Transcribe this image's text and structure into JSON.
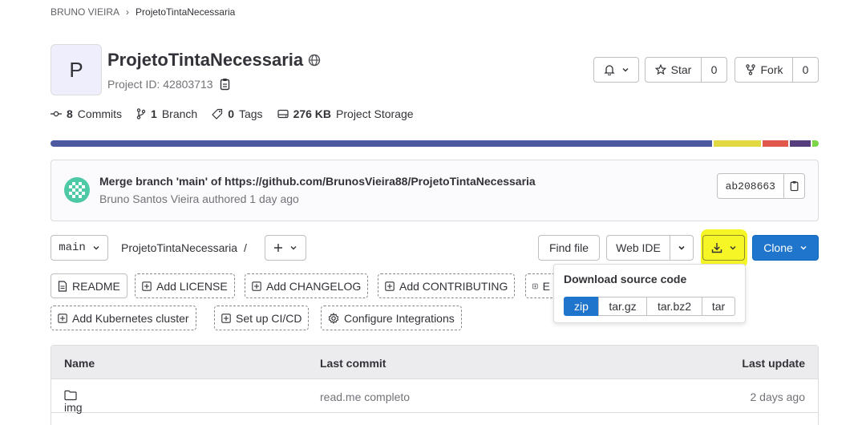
{
  "breadcrumb": {
    "owner": "BRUNO VIEIRA",
    "separator": "›",
    "project": "ProjetoTintaNecessaria"
  },
  "project": {
    "avatar_letter": "P",
    "name": "ProjetoTintaNecessaria",
    "id_text": "Project ID: 42803713"
  },
  "actions": {
    "star_label": "Star",
    "star_count": "0",
    "fork_label": "Fork",
    "fork_count": "0"
  },
  "stats": {
    "commits_count": "8",
    "commits_label": "Commits",
    "branch_count": "1",
    "branch_label": "Branch",
    "tags_count": "0",
    "tags_label": "Tags",
    "storage_size": "276 KB",
    "storage_label": "Project Storage"
  },
  "language_colors": [
    "#4c59a0",
    "#e1d844",
    "#e2574c",
    "#563d7c",
    "#7dd64a"
  ],
  "commit": {
    "message": "Merge branch 'main' of https://github.com/BrunosVieira88/ProjetoTintaNecessaria",
    "author_line": "Bruno Santos Vieira authored 1 day ago",
    "sha": "ab208663"
  },
  "repo_toolbar": {
    "branch": "main",
    "path": "ProjetoTintaNecessaria",
    "path_sep": "/",
    "find_file": "Find file",
    "web_ide": "Web IDE",
    "clone": "Clone"
  },
  "quick_actions": {
    "readme": "README",
    "license": "Add LICENSE",
    "changelog": "Add CHANGELOG",
    "contributing": "Add CONTRIBUTING",
    "hidden_partial": "E",
    "kubernetes": "Add Kubernetes cluster",
    "cicd": "Set up CI/CD",
    "integrations": "Configure Integrations"
  },
  "download_dropdown": {
    "title": "Download source code",
    "formats": [
      "zip",
      "tar.gz",
      "tar.bz2",
      "tar"
    ],
    "selected": "zip"
  },
  "table": {
    "headers": {
      "name": "Name",
      "last_commit": "Last commit",
      "last_update": "Last update"
    },
    "rows": [
      {
        "name": "img",
        "commit": "read.me completo",
        "updated": "2 days ago"
      }
    ]
  },
  "colors": {
    "accent": "#1f75cb",
    "highlight": "#f5f500"
  }
}
